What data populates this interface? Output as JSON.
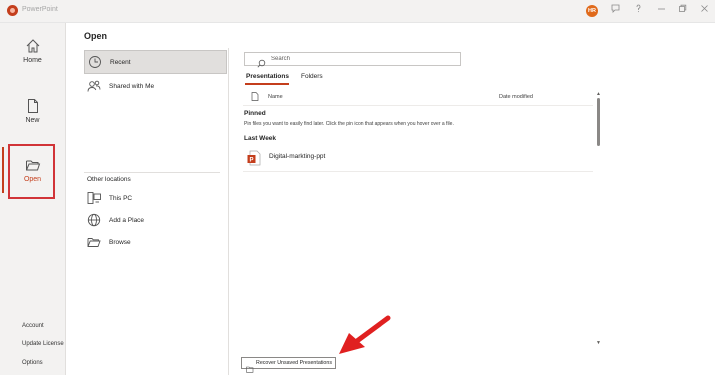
{
  "titlebar": {
    "app_title": "PowerPoint",
    "avatar_initials": "HR",
    "icons": [
      "feedback-icon",
      "help-icon",
      "minimize-icon",
      "restore-icon",
      "close-icon"
    ]
  },
  "leftnav": {
    "home": "Home",
    "new": "New",
    "open": "Open",
    "account": "Account",
    "update_license": "Update License",
    "options": "Options"
  },
  "middle": {
    "title": "Open",
    "recent": "Recent",
    "shared": "Shared with Me",
    "other_locations": "Other locations",
    "this_pc": "This PC",
    "add_place": "Add a Place",
    "browse": "Browse"
  },
  "right": {
    "search_placeholder": "Search",
    "tabs": {
      "presentations": "Presentations",
      "folders": "Folders"
    },
    "columns": {
      "name": "Name",
      "date_modified": "Date modified"
    },
    "pinned_title": "Pinned",
    "pinned_desc": "Pin files you want to easily find later. Click the pin icon that appears when you hover over a file.",
    "last_week_title": "Last Week",
    "files": [
      {
        "name": "Digital-markting-ppt"
      }
    ]
  },
  "recover_button": "Recover Unsaved Presentations",
  "colors": {
    "accent": "#c43e1c",
    "highlight_box": "#d13438",
    "arrow": "#e02020",
    "nav_bg": "#f3f2f1"
  }
}
